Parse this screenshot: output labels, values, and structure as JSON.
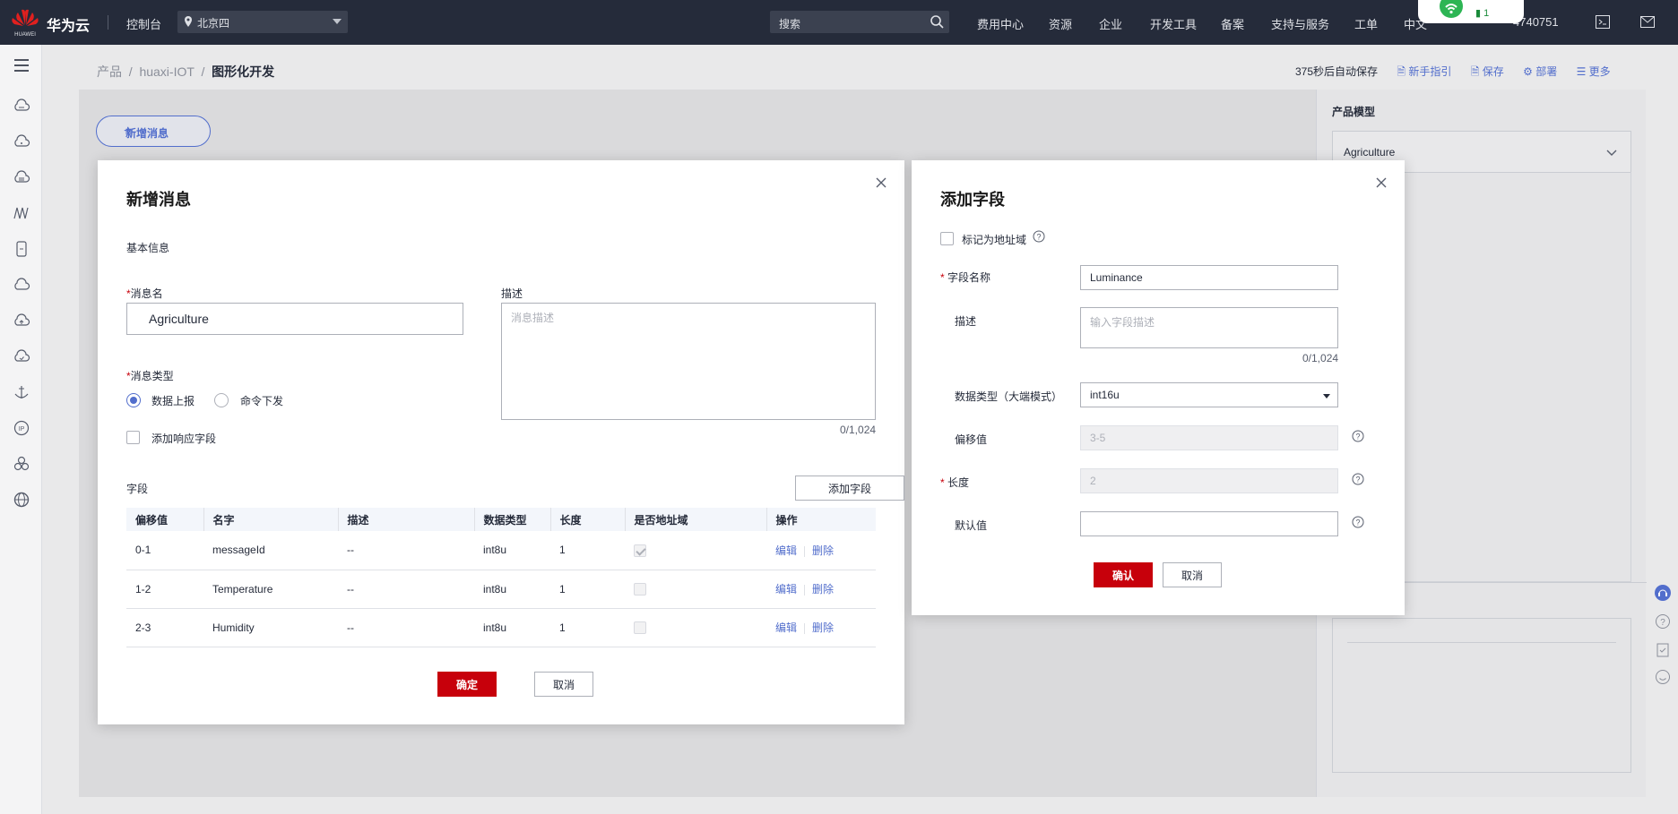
{
  "header": {
    "logo_text": "HUAWEI",
    "brand": "华为云",
    "console": "控制台",
    "region": "北京四",
    "search_placeholder": "搜索",
    "nav": [
      "费用中心",
      "资源",
      "企业",
      "开发工具",
      "备案",
      "支持与服务",
      "工单",
      "中文",
      "4740751"
    ],
    "popup_battery": "1"
  },
  "sidebar": {
    "icons": [
      "menu-icon",
      "cloud-icon",
      "cloud-service-icon",
      "cloud-db-icon",
      "monitor-icon",
      "device-icon",
      "cloud-outline-icon",
      "cloud-upload-icon",
      "cloud-check-icon",
      "anchor-icon",
      "ip-icon",
      "cluster-icon",
      "globe-icon"
    ]
  },
  "breadcrumb": {
    "items": [
      "产品",
      "huaxi-IOT"
    ],
    "current": "图形化开发"
  },
  "toolbar": {
    "autosave": "375秒后自动保存",
    "guide": "新手指引",
    "save": "保存",
    "deploy": "部署",
    "more": "更多"
  },
  "canvas": {
    "new_message_button": "新增消息"
  },
  "right_panel": {
    "title": "产品模型",
    "selected_model": "Agriculture"
  },
  "message_dialog": {
    "title": "新增消息",
    "section_basic": "基本信息",
    "name_label": "消息名",
    "name_value": "Agriculture",
    "desc_label": "描述",
    "desc_placeholder": "消息描述",
    "desc_counter": "0/1,024",
    "type_label": "消息类型",
    "type_options": [
      "数据上报",
      "命令下发"
    ],
    "type_selected": "数据上报",
    "response_checkbox": "添加响应字段",
    "fields_label": "字段",
    "add_field_button": "添加字段",
    "table": {
      "headers": [
        "偏移值",
        "名字",
        "描述",
        "数据类型",
        "长度",
        "是否地址域",
        "操作"
      ],
      "rows": [
        {
          "offset": "0-1",
          "name": "messageId",
          "desc": "--",
          "type": "int8u",
          "length": "1",
          "is_address": true
        },
        {
          "offset": "1-2",
          "name": "Temperature",
          "desc": "--",
          "type": "int8u",
          "length": "1",
          "is_address": false
        },
        {
          "offset": "2-3",
          "name": "Humidity",
          "desc": "--",
          "type": "int8u",
          "length": "1",
          "is_address": false
        }
      ],
      "edit": "编辑",
      "delete": "删除"
    },
    "confirm": "确定",
    "cancel": "取消"
  },
  "field_dialog": {
    "title": "添加字段",
    "address_checkbox": "标记为地址域",
    "name_label": "字段名称",
    "name_value": "Luminance",
    "desc_label": "描述",
    "desc_placeholder": "输入字段描述",
    "desc_counter": "0/1,024",
    "type_label": "数据类型（大端模式）",
    "type_value": "int16u",
    "offset_label": "偏移值",
    "offset_value": "3-5",
    "length_label": "长度",
    "length_value": "2",
    "default_label": "默认值",
    "default_value": "",
    "confirm": "确认",
    "cancel": "取消"
  },
  "colors": {
    "topbar": "#252b3a",
    "primary_button": "#c7000b",
    "link": "#526ecc"
  }
}
